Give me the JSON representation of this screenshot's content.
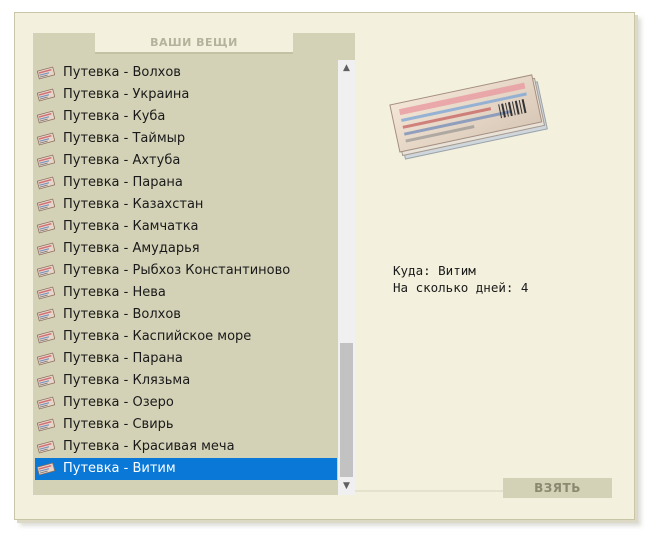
{
  "panel": {
    "header": "ВАШИ ВЕЩИ"
  },
  "items": [
    {
      "label": "Путевка - Волхов"
    },
    {
      "label": "Путевка - Украина"
    },
    {
      "label": "Путевка - Куба"
    },
    {
      "label": "Путевка - Таймыр"
    },
    {
      "label": "Путевка - Ахтуба"
    },
    {
      "label": "Путевка - Парана"
    },
    {
      "label": "Путевка - Казахстан"
    },
    {
      "label": "Путевка - Камчатка"
    },
    {
      "label": "Путевка - Амударья"
    },
    {
      "label": "Путевка - Рыбхоз Константиново"
    },
    {
      "label": "Путевка - Нева"
    },
    {
      "label": "Путевка - Волхов"
    },
    {
      "label": "Путевка - Каспийское море"
    },
    {
      "label": "Путевка - Парана"
    },
    {
      "label": "Путевка - Клязьма"
    },
    {
      "label": "Путевка - Озеро"
    },
    {
      "label": "Путевка - Свирь"
    },
    {
      "label": "Путевка - Красивая меча"
    },
    {
      "label": "Путевка - Витим",
      "selected": true
    }
  ],
  "details": {
    "destination": "Куда: Витим",
    "days": "На сколько дней: 4"
  },
  "actions": {
    "take_label": "ВЗЯТЬ"
  },
  "colors": {
    "window_bg": "#f3f1dd",
    "panel_bg": "#d3d1b6",
    "selection": "#0a78d6"
  },
  "icons": {
    "item": "ticket-icon",
    "preview": "ticket-stack-image"
  }
}
